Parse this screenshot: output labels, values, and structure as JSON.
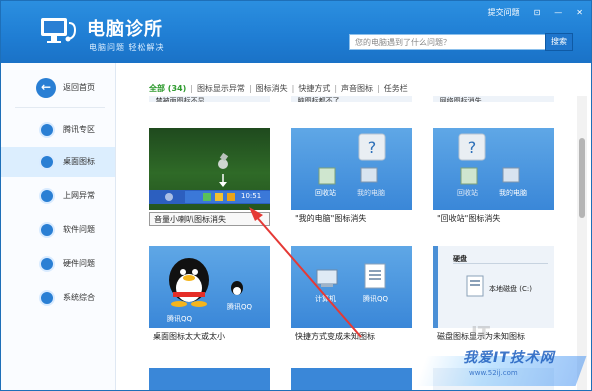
{
  "app": {
    "title": "电脑诊所",
    "subtitle": "电脑问题 轻松解决",
    "top_links": [
      "提交问题",
      "⊡",
      "—",
      "✕"
    ],
    "search_placeholder": "您的电脑遇到了什么问题？",
    "search_button": "搜索"
  },
  "sidebar": {
    "back": "返回首页",
    "items": [
      {
        "label": "腾讯专区",
        "icon": "tencent-icon",
        "active": false
      },
      {
        "label": "桌面图标",
        "icon": "desktop-icon",
        "active": true
      },
      {
        "label": "上网异常",
        "icon": "ie-icon",
        "active": false
      },
      {
        "label": "软件问题",
        "icon": "software-icon",
        "active": false
      },
      {
        "label": "硬件问题",
        "icon": "hardware-icon",
        "active": false
      },
      {
        "label": "系统综合",
        "icon": "windows-icon",
        "active": false
      }
    ]
  },
  "tabs": [
    "全部 (34)",
    "图标显示异常",
    "图标消失",
    "快捷方式",
    "声音图标",
    "任务栏"
  ],
  "cards": [
    {
      "caption": "音量小喇叭图标消失",
      "thumb_text": [
        "10:51"
      ]
    },
    {
      "caption": "\"我的电脑\"图标消失",
      "thumb_text": [
        "回收站",
        "我的电脑"
      ]
    },
    {
      "caption": "\"回收站\"图标消失",
      "thumb_text": [
        "回收站",
        "我的电脑"
      ]
    },
    {
      "caption": "桌面图标太大或太小",
      "thumb_text": [
        "腾讯QQ",
        "腾讯QQ"
      ]
    },
    {
      "caption": "快捷方式变成未知图标",
      "thumb_text": [
        "计算机",
        "腾讯QQ"
      ]
    },
    {
      "caption": "磁盘图标显示为未知图标",
      "thumb_text": [
        "硬盘",
        "本地磁盘 (C:)"
      ]
    }
  ],
  "top_partial": [
    "...禁被面图标不显...",
    "...脑图标都不了",
    "...网络图标消失"
  ],
  "watermark": {
    "main": "我爱IT技术网",
    "sub": "www.52ij.com"
  },
  "colors": {
    "header": "#1f7dd3",
    "accent": "#2a7fd4",
    "tab_active": "#2d9a2d",
    "arrow": "#e53935"
  }
}
